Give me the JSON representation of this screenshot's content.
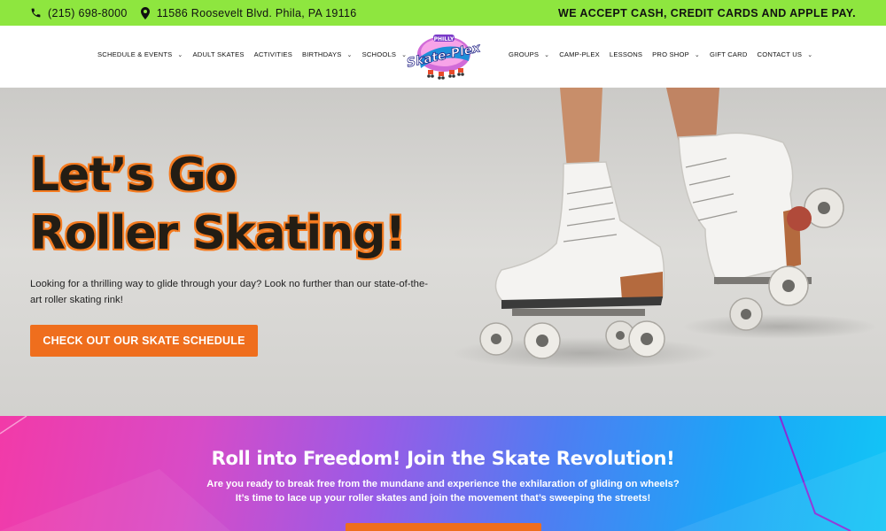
{
  "topbar": {
    "phone": "(215) 698-8000",
    "address": "11586 Roosevelt Blvd. Phila, PA 19116",
    "payment_notice": "WE ACCEPT CASH, CREDIT CARDS AND APPLE PAY.",
    "phone_icon": "phone-icon",
    "location_icon": "location-pin-icon"
  },
  "nav": {
    "left_items": [
      {
        "label": "SCHEDULE & EVENTS",
        "dropdown": true
      },
      {
        "label": "ADULT SKATES",
        "dropdown": false
      },
      {
        "label": "ACTIVITIES",
        "dropdown": false
      },
      {
        "label": "BIRTHDAYS",
        "dropdown": true
      },
      {
        "label": "SCHOOLS",
        "dropdown": true
      }
    ],
    "right_items": [
      {
        "label": "GROUPS",
        "dropdown": true
      },
      {
        "label": "CAMP-PLEX",
        "dropdown": false
      },
      {
        "label": "LESSONS",
        "dropdown": false
      },
      {
        "label": "PRO SHOP",
        "dropdown": true
      },
      {
        "label": "GIFT CARD",
        "dropdown": false
      },
      {
        "label": "CONTACT US",
        "dropdown": true
      }
    ],
    "caret": "⌄",
    "logo": {
      "top": "PHILLY",
      "main": "Skate-Plex"
    }
  },
  "hero": {
    "title_line1": "Let’s Go",
    "title_line2": "Roller Skating!",
    "description": "Looking for a thrilling way to glide through your day? Look no further than our state-of-the-art roller skating rink!",
    "cta_label": "CHECK OUT OUR SKATE SCHEDULE"
  },
  "promo": {
    "heading": "Roll into Freedom! Join the Skate Revolution!",
    "text": "Are you ready to break free from the mundane and experience the exhilaration of gliding on wheels? It’s time to lace up your roller skates and join the movement that’s sweeping the streets!"
  },
  "colors": {
    "topbar": "#8ee63f",
    "accent_orange": "#ef6e1d",
    "promo_pink": "#f23aa8",
    "promo_blue": "#12c6f6"
  }
}
